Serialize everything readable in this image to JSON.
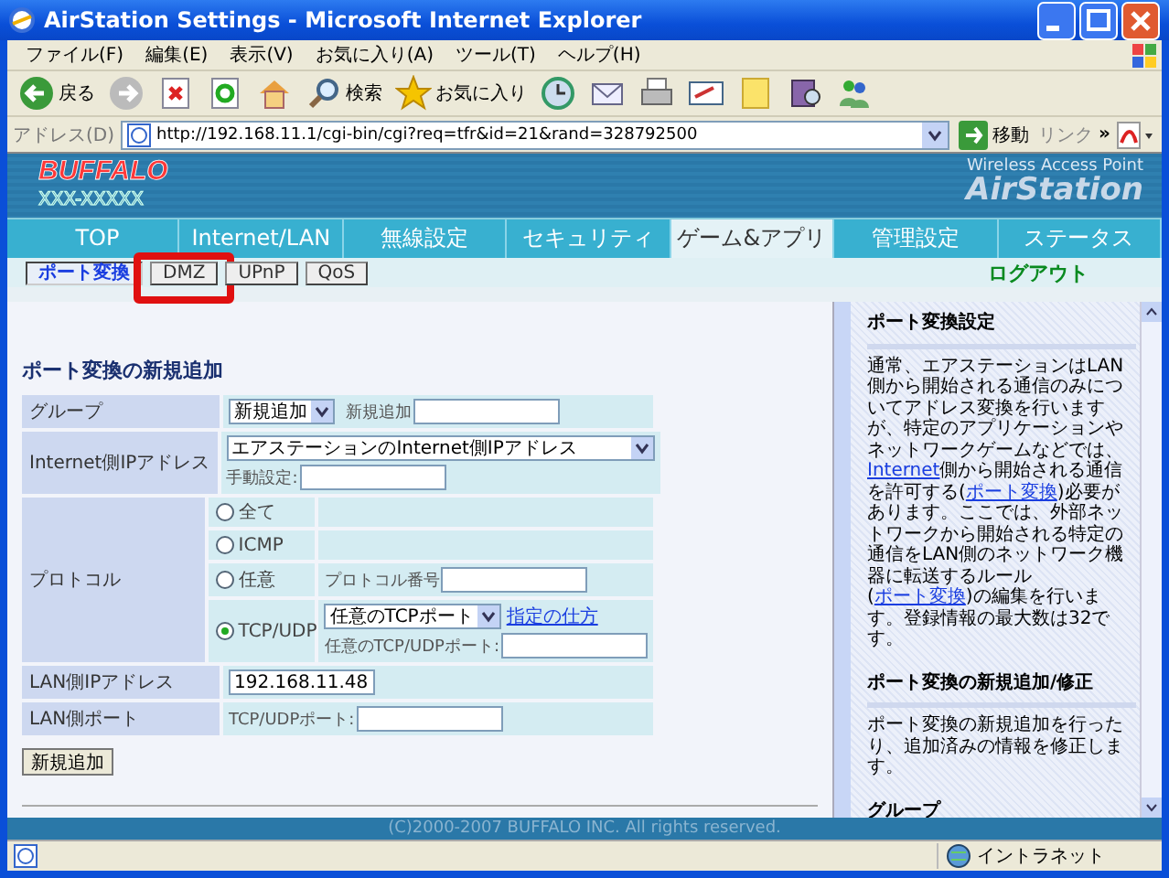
{
  "window": {
    "title": "AirStation Settings - Microsoft Internet Explorer"
  },
  "menu": [
    "ファイル(F)",
    "編集(E)",
    "表示(V)",
    "お気に入り(A)",
    "ツール(T)",
    "ヘルプ(H)"
  ],
  "toolbar": [
    {
      "kind": "back",
      "label": "戻る"
    },
    {
      "kind": "forward"
    },
    {
      "kind": "stop"
    },
    {
      "kind": "refresh"
    },
    {
      "kind": "home"
    },
    {
      "kind": "search",
      "label": "検索"
    },
    {
      "kind": "favorites",
      "label": "お気に入り"
    },
    {
      "kind": "history"
    },
    {
      "kind": "mail"
    },
    {
      "kind": "print"
    },
    {
      "kind": "edit"
    },
    {
      "kind": "note"
    },
    {
      "kind": "research"
    },
    {
      "kind": "messenger"
    }
  ],
  "address": {
    "label": "アドレス(D)",
    "value": "http://192.168.11.1/cgi-bin/cgi?req=tfr&id=21&rand=328792500",
    "go": "移動",
    "links": "リンク",
    "more": "»"
  },
  "banner": {
    "brand": "BUFFALO",
    "model": "XXX-XXXXX",
    "subtitle": "Wireless Access Point",
    "product": "AirStation"
  },
  "tabs": [
    {
      "label": "TOP",
      "selected": false
    },
    {
      "label": "Internet/LAN",
      "selected": false
    },
    {
      "label": "無線設定",
      "selected": false
    },
    {
      "label": "セキュリティ",
      "selected": false
    },
    {
      "label": "ゲーム&アプリ",
      "selected": true
    },
    {
      "label": "管理設定",
      "selected": false
    },
    {
      "label": "ステータス",
      "selected": false
    }
  ],
  "subtabs": [
    {
      "label": "ポート変換",
      "selected": true,
      "highlighted": false
    },
    {
      "label": "DMZ",
      "selected": false,
      "highlighted": true
    },
    {
      "label": "UPnP",
      "selected": false,
      "highlighted": false
    },
    {
      "label": "QoS",
      "selected": false,
      "highlighted": false
    }
  ],
  "logout": "ログアウト",
  "form": {
    "title": "ポート変換の新規追加",
    "rows": [
      {
        "kind": "field",
        "label": "グループ",
        "select": "新規追加",
        "field_label": "新規追加"
      },
      {
        "kind": "field",
        "label": "Internet側IPアドレス",
        "select": "エアステーションのInternet側IPアドレス",
        "field_label": "手動設定:"
      },
      {
        "kind": "protocol",
        "label": "プロトコル",
        "options": [
          {
            "label": "全て",
            "selected": false
          },
          {
            "label": "ICMP",
            "selected": false
          },
          {
            "label": "任意",
            "selected": false,
            "field_label": "プロトコル番号"
          },
          {
            "label": "TCP/UDP",
            "selected": true,
            "select": "任意のTCPポート",
            "link": "指定の仕方",
            "field_label": "任意のTCP/UDPポート:"
          }
        ]
      },
      {
        "kind": "field",
        "label": "LAN側IPアドレス",
        "value": "192.168.11.48"
      },
      {
        "kind": "field",
        "label": "LAN側ポート",
        "field_label": "TCP/UDPポート:"
      }
    ],
    "submit": "新規追加"
  },
  "help": [
    {
      "heading": "ポート変換設定",
      "paragraph": [
        {
          "kind": "text",
          "text": "通常、エアステーションはLAN側から開始される通信のみについてアドレス変換を行いますが、特定のアプリケーションやネットワークゲームなどでは、"
        },
        {
          "kind": "link",
          "text": "Internet"
        },
        {
          "kind": "text",
          "text": "側から開始される通信を許可する("
        },
        {
          "kind": "link",
          "text": "ポート変換"
        },
        {
          "kind": "text",
          "text": ")必要があります。ここでは、外部ネットワークから開始される特定の通信をLAN側のネットワーク機器に転送するルール("
        },
        {
          "kind": "link",
          "text": "ポート変換"
        },
        {
          "kind": "text",
          "text": ")の編集を行います。登録情報の最大数は32です。"
        }
      ]
    },
    {
      "heading": "ポート変換の新規追加/修正",
      "paragraph": [
        {
          "kind": "text",
          "text": "ポート変換の新規追加を行ったり、追加済みの情報を修正します。"
        }
      ]
    },
    {
      "heading": "グループ"
    }
  ],
  "footer": "(C)2000-2007 BUFFALO INC. All rights reserved.",
  "status": {
    "zone": "イントラネット"
  }
}
